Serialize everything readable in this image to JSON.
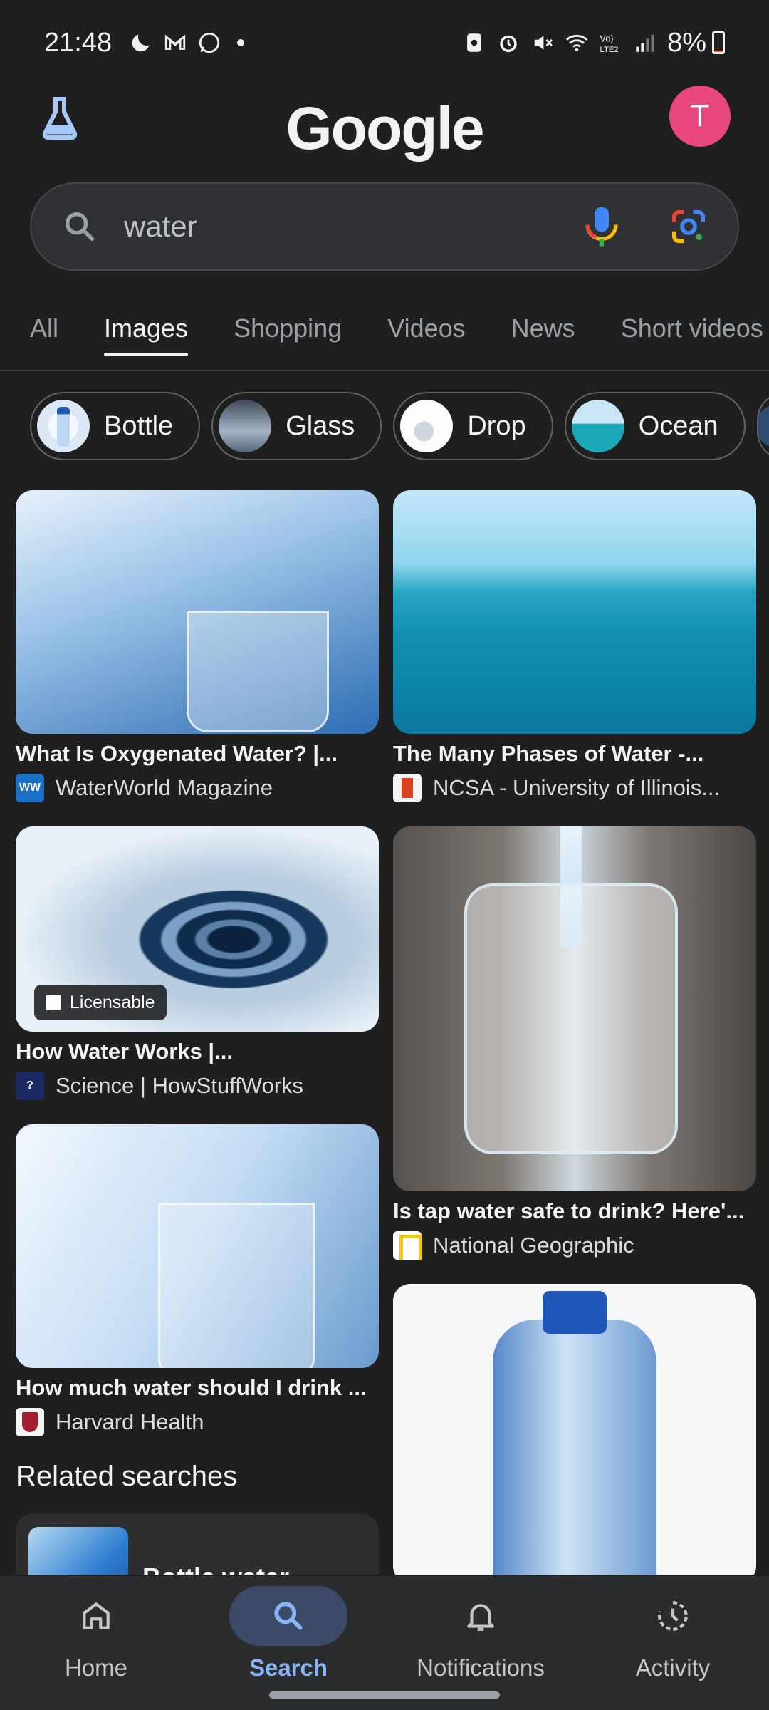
{
  "status_bar": {
    "time": "21:48",
    "battery": "8%",
    "battery_level": 0.08
  },
  "header": {
    "logo": "Google",
    "avatar_letter": "T",
    "avatar_color": "#e8477f"
  },
  "search": {
    "query": "water"
  },
  "tabs": [
    "All",
    "Images",
    "Shopping",
    "Videos",
    "News",
    "Short videos"
  ],
  "active_tab": "Images",
  "chips": [
    "Bottle",
    "Glass",
    "Drop",
    "Ocean"
  ],
  "results": {
    "r1": {
      "title": "What Is Oxygenated Water? |...",
      "source": "WaterWorld Magazine",
      "favicon_text": "WW"
    },
    "r2": {
      "title": "The Many Phases of Water -...",
      "source": "NCSA - University of Illinois..."
    },
    "r3": {
      "title": "How Water Works |...",
      "source": "Science | HowStuffWorks",
      "badge": "Licensable",
      "favicon_text": "?"
    },
    "r4": {
      "title": "Is tap water safe to drink? Here'...",
      "source": "National Geographic"
    },
    "r5": {
      "title": "How much water should I drink ...",
      "source": "Harvard Health"
    }
  },
  "related": {
    "heading": "Related searches",
    "items": [
      "Bottle water"
    ]
  },
  "bottom_nav": [
    "Home",
    "Search",
    "Notifications",
    "Activity"
  ],
  "active_nav": "Search",
  "colors": {
    "background": "#1f1f1f",
    "accent": "#8ab4f8",
    "nav_pill": "#3c4a67"
  }
}
